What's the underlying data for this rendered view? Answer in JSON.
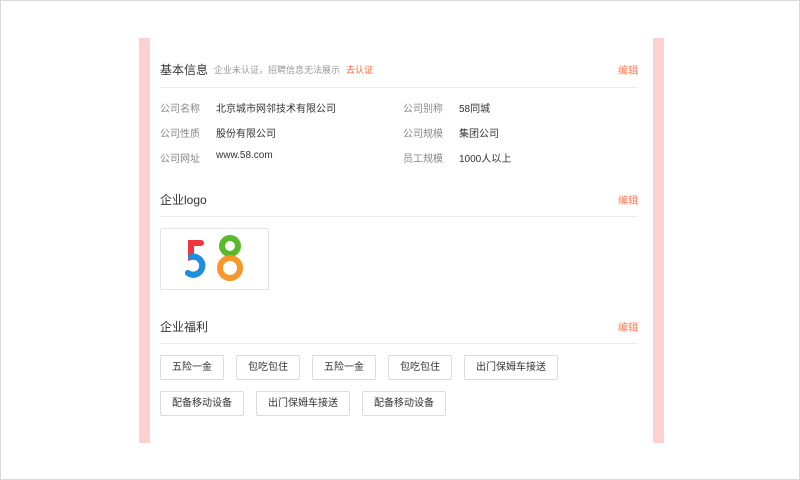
{
  "basic": {
    "title": "基本信息",
    "note": "企业未认证，招聘信息无法展示",
    "verify_link": "去认证",
    "edit": "编辑",
    "fields": [
      {
        "label": "公司名称",
        "value": "北京城市网邻技术有限公司"
      },
      {
        "label": "公司别称",
        "value": "58同城"
      },
      {
        "label": "公司性质",
        "value": "股份有限公司"
      },
      {
        "label": "公司规模",
        "value": "集团公司"
      },
      {
        "label": "公司网址",
        "value": "www.58.com"
      },
      {
        "label": "员工规模",
        "value": "1000人以上"
      }
    ]
  },
  "logo": {
    "title": "企业logo",
    "edit": "编辑",
    "logo_text": "58"
  },
  "welfare": {
    "title": "企业福利",
    "edit": "编辑",
    "tags": [
      "五险一金",
      "包吃包住",
      "五险一金",
      "包吃包住",
      "出门保姆车接送",
      "配备移动设备",
      "出门保姆车接送",
      "配备移动设备"
    ]
  },
  "colors": {
    "accent": "#ff7a55",
    "side": "#ffd0d0"
  }
}
